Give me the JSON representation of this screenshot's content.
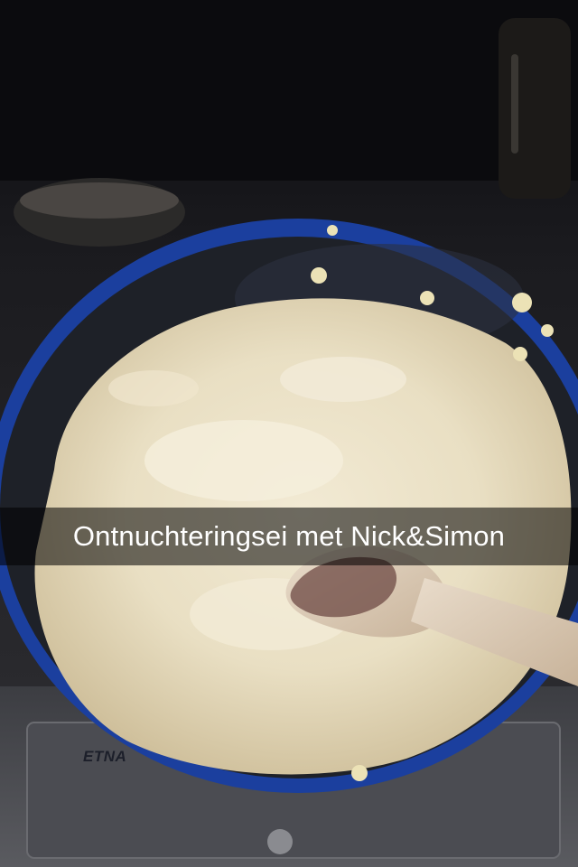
{
  "caption": {
    "text": "Ontnuchteringsei met Nick&Simon"
  },
  "stove": {
    "brand": "ETNA"
  },
  "colors": {
    "pan_rim": "#1b3f9e",
    "pan_inner": "#1e2128",
    "sauce": "#e8dec4",
    "spoon": "#d9c7b1",
    "caption_bar": "rgba(0,0,0,0.55)",
    "caption_text": "#ffffff"
  }
}
